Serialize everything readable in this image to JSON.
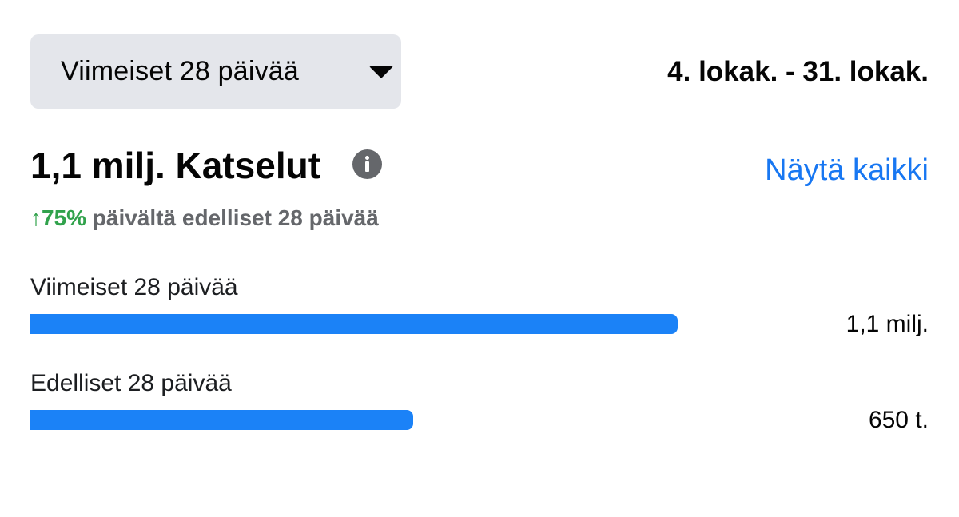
{
  "period_selector": {
    "label": "Viimeiset 28 päivää",
    "icon": "caret-down-icon"
  },
  "date_range": "4. lokak. - 31. lokak.",
  "metric": {
    "title": "1,1 milj. Katselut",
    "info_icon": "info-icon",
    "see_all": "Näytä kaikki",
    "change": {
      "arrow": "↑",
      "percent": "75%",
      "text": "päivältä edelliset 28 päivää",
      "color": "#31a24c"
    }
  },
  "chart_data": {
    "type": "bar",
    "orientation": "horizontal",
    "categories": [
      "Viimeiset 28 päivää",
      "Edelliset 28 päivää"
    ],
    "values": [
      1100000,
      650000
    ],
    "value_labels": [
      "1,1 milj.",
      "650 t."
    ],
    "bar_color": "#1b82f7",
    "xlim": [
      0,
      1100000
    ]
  }
}
